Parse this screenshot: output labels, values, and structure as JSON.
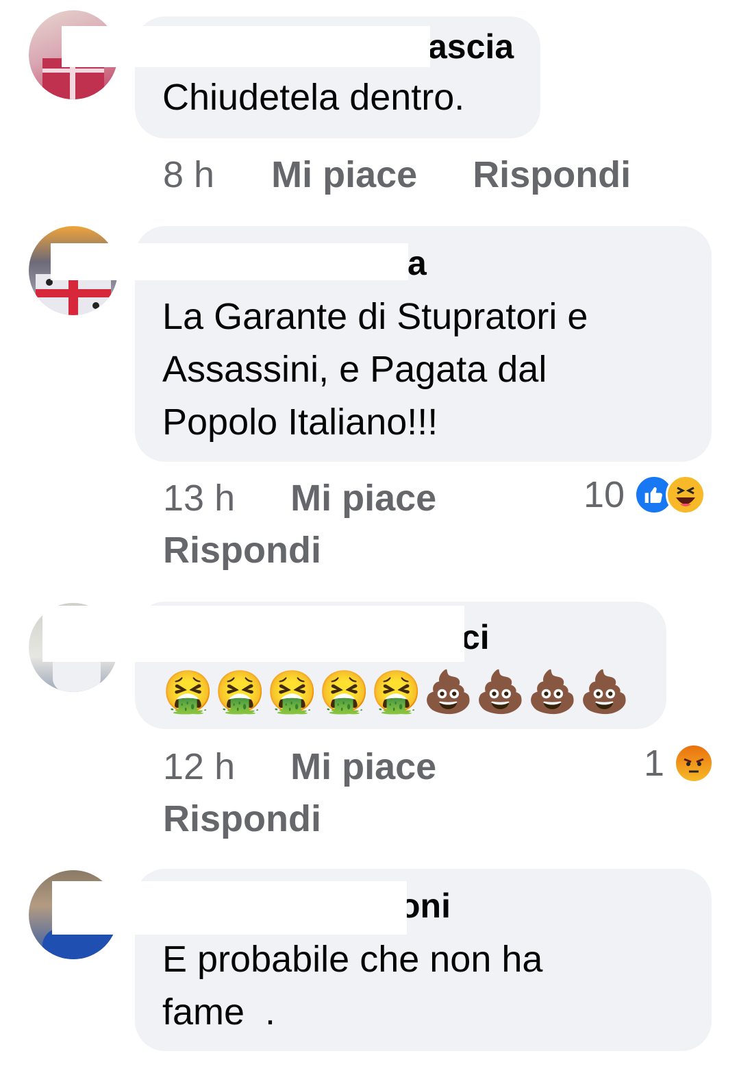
{
  "comments": [
    {
      "name_visible": "ascia",
      "text": "Chiudetela dentro.",
      "time": "8 h",
      "like_label": "Mi piace",
      "reply_label": "Rispondi"
    },
    {
      "name_visible": "a",
      "text_lines": [
        "La Garante di Stupratori e",
        "Assassini, e Pagata dal",
        "Popolo Italiano!!!"
      ],
      "time": "13 h",
      "like_label": "Mi piace",
      "reply_label": "Rispondi",
      "reaction_count": "10",
      "reactions": [
        "like-icon",
        "haha-icon"
      ]
    },
    {
      "name_visible": "ci",
      "emojis": [
        "🤮",
        "🤮",
        "🤮",
        "🤮",
        "🤮",
        "💩",
        "💩",
        "💩",
        "💩"
      ],
      "time": "12 h",
      "like_label": "Mi piace",
      "reply_label": "Rispondi",
      "reaction_count": "1",
      "reactions": [
        "angry-icon"
      ]
    },
    {
      "name_visible": "oni",
      "text_lines": [
        "E probabile che non ha",
        "fame  ."
      ]
    }
  ],
  "colors": {
    "bubble": "#f0f2f5",
    "meta": "#65676b",
    "like_blue": "#1877f2",
    "haha_yellow": "#f7b928",
    "angry_orange": "#e9710f"
  }
}
